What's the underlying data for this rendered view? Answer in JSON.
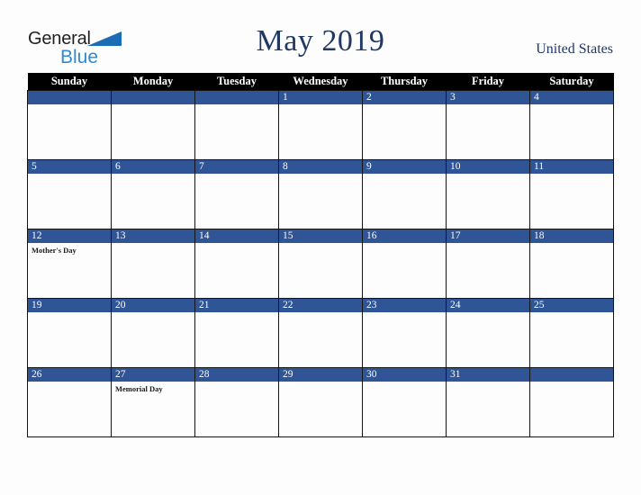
{
  "brand": {
    "word1": "General",
    "word2": "Blue",
    "triangle_color": "#1b6cb5",
    "word1_color": "#231f20",
    "word2_color": "#2e8ad6"
  },
  "header": {
    "title": "May 2019",
    "country": "United States",
    "title_color": "#1f3864"
  },
  "colors": {
    "header_row_bg": "#000000",
    "header_row_text": "#ffffff",
    "date_bar_bg": "#2f5597",
    "date_bar_text": "#ffffff",
    "cell_bg": "#fdfdfd",
    "grid_line": "#141414",
    "page_bg": "#fdfdfd"
  },
  "weekdays": [
    "Sunday",
    "Monday",
    "Tuesday",
    "Wednesday",
    "Thursday",
    "Friday",
    "Saturday"
  ],
  "weeks": [
    [
      {
        "date": "",
        "events": []
      },
      {
        "date": "",
        "events": []
      },
      {
        "date": "",
        "events": []
      },
      {
        "date": "1",
        "events": []
      },
      {
        "date": "2",
        "events": []
      },
      {
        "date": "3",
        "events": []
      },
      {
        "date": "4",
        "events": []
      }
    ],
    [
      {
        "date": "5",
        "events": []
      },
      {
        "date": "6",
        "events": []
      },
      {
        "date": "7",
        "events": []
      },
      {
        "date": "8",
        "events": []
      },
      {
        "date": "9",
        "events": []
      },
      {
        "date": "10",
        "events": []
      },
      {
        "date": "11",
        "events": []
      }
    ],
    [
      {
        "date": "12",
        "events": [
          "Mother's Day"
        ]
      },
      {
        "date": "13",
        "events": []
      },
      {
        "date": "14",
        "events": []
      },
      {
        "date": "15",
        "events": []
      },
      {
        "date": "16",
        "events": []
      },
      {
        "date": "17",
        "events": []
      },
      {
        "date": "18",
        "events": []
      }
    ],
    [
      {
        "date": "19",
        "events": []
      },
      {
        "date": "20",
        "events": []
      },
      {
        "date": "21",
        "events": []
      },
      {
        "date": "22",
        "events": []
      },
      {
        "date": "23",
        "events": []
      },
      {
        "date": "24",
        "events": []
      },
      {
        "date": "25",
        "events": []
      }
    ],
    [
      {
        "date": "26",
        "events": []
      },
      {
        "date": "27",
        "events": [
          "Memorial Day"
        ]
      },
      {
        "date": "28",
        "events": []
      },
      {
        "date": "29",
        "events": []
      },
      {
        "date": "30",
        "events": []
      },
      {
        "date": "31",
        "events": []
      },
      {
        "date": "",
        "events": []
      }
    ]
  ]
}
